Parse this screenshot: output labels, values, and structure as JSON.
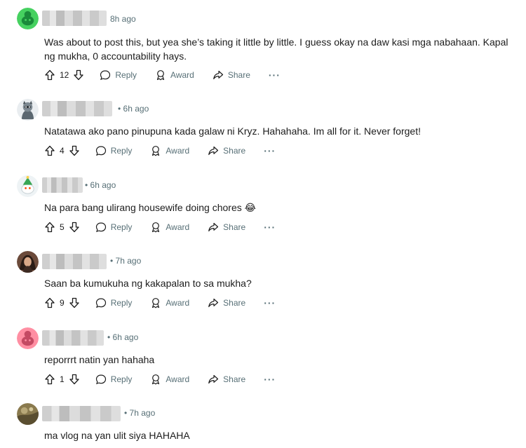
{
  "comments": [
    {
      "time": "8h ago",
      "text": "Was about to post this, but yea she’s taking it little by little. I guess okay na daw kasi mga nabahaan. Kapal ng mukha, 0 accountability hays.",
      "votes": "12",
      "avatar": "green-snoo-avatar"
    },
    {
      "time": "• 6h ago",
      "text": "Natatawa ako pano pinupuna kada galaw ni Kryz. Hahahaha. Im all for it. Never forget!",
      "votes": "4",
      "avatar": "gray-character-avatar"
    },
    {
      "time": "• 6h ago",
      "text": "Na para bang ulirang housewife doing chores 😂",
      "votes": "5",
      "avatar": "snoo-christmas-hat-avatar"
    },
    {
      "time": "• 7h ago",
      "text": "Saan ba kumukuha ng kakapalan to sa mukha?",
      "votes": "9",
      "avatar": "photo-avatar"
    },
    {
      "time": "• 6h ago",
      "text": "reporrrt natin yan hahaha",
      "votes": "1",
      "avatar": "pink-snoo-avatar"
    },
    {
      "time": "• 7h ago",
      "text": "ma vlog na yan ulit siya HAHAHA",
      "avatar": "photo-avatar"
    }
  ],
  "actions": {
    "reply": "Reply",
    "award": "Award",
    "share": "Share",
    "more": "···"
  },
  "colors": {
    "meta": "#576f76",
    "text": "#1c1c1c"
  }
}
